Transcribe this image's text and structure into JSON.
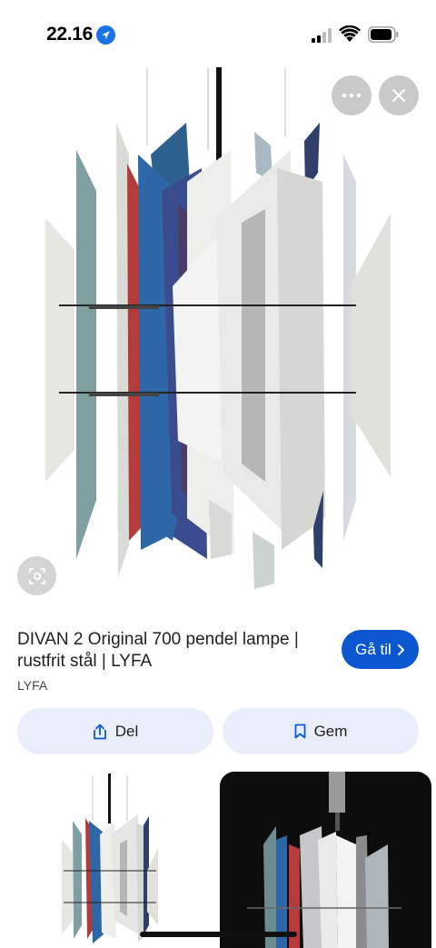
{
  "status_bar": {
    "time": "22.16"
  },
  "product": {
    "title": "DIVAN 2 Original 700 pendel lampe | rustfrit stål | LYFA",
    "source": "LYFA",
    "visit_label": "Gå til"
  },
  "actions": {
    "share_label": "Del",
    "save_label": "Gem"
  },
  "colors": {
    "accent": "#0b57d0",
    "chip_bg": "#e9eefa"
  }
}
